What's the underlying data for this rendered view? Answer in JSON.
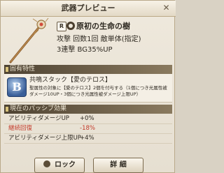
{
  "header": {
    "title": "武器プレビュー"
  },
  "weapon": {
    "rarity_label": "R",
    "element_icon": "dark-element-icon",
    "name": "原初の生命の樹",
    "stats_line1": "攻撃 回数1回 敵単体(指定)",
    "stats_line2": "3連撃 BG35%UP"
  },
  "trait_section": {
    "title": "固有特性",
    "icon_letter": "B",
    "name": "共鳴スタック【愛のテロス】",
    "description": "聖属性の対象に【愛のテロス】2個を付与する（1個につき光属性被ダメージ10UP・3個につき光属性被ダメージ上限UP）"
  },
  "passive_section": {
    "title": "現在のパッシブ効果",
    "rows": [
      {
        "label": "アビリティダメージUP",
        "value": "+0%",
        "debuff": false
      },
      {
        "label": "継続回復",
        "value": "-18%",
        "debuff": true
      },
      {
        "label": "アビリティダメージ上限UP",
        "value": "+4%",
        "debuff": false
      }
    ]
  },
  "buttons": {
    "lock": "ロック",
    "detail": "詳 細"
  }
}
